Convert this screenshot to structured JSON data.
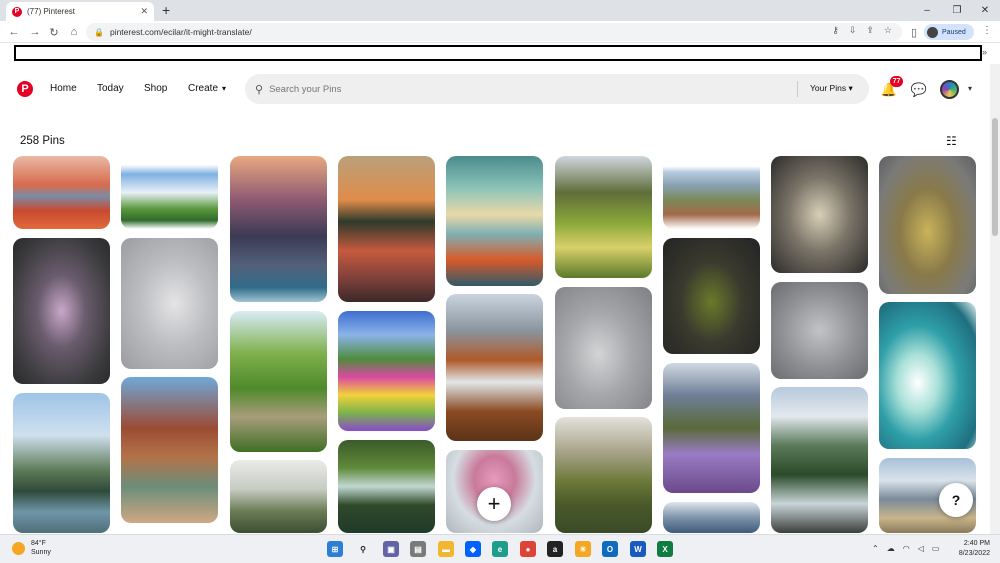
{
  "browser": {
    "tab_title": "(77) Pinterest",
    "tab_close": "✕",
    "new_tab": "+",
    "url": "pinterest.com/ecilar/it-might-translate/",
    "profile_label": "Paused",
    "window_controls": [
      "–",
      "❐",
      "✕"
    ],
    "more_bookmarks": "»"
  },
  "header": {
    "logo": "P",
    "nav": [
      "Home",
      "Today",
      "Shop",
      "Create"
    ],
    "create_chevron": "▾",
    "search_placeholder": "Search your Pins",
    "your_pins": "Your Pins",
    "your_pins_chevron": "▾",
    "notification_count": "77"
  },
  "board": {
    "pin_count": "258 Pins"
  },
  "fab": {
    "add": "+",
    "help": "?"
  },
  "taskbar": {
    "weather_temp": "84°F",
    "weather_desc": "Sunny",
    "time": "2:40 PM",
    "date": "8/23/2022"
  },
  "colors": {
    "pinterest_red": "#e60023",
    "search_bg": "#efefef"
  },
  "pins": [
    {
      "name": "pin-red-desert-lake",
      "bg": "linear-gradient(180deg,#e8b9a5 0%,#d86a4d 40%,#7b8da6 55%,#c9492f 75%,#e26a3b 100%)"
    },
    {
      "name": "pin-dancer-purple-gown",
      "bg": "radial-gradient(ellipse at 50% 50%,#c9a7c8 0%,#6a5c6e 35%,#3b3b3d 75%,#2a2a2c 100%)"
    },
    {
      "name": "pin-mountain-lake-forest",
      "bg": "linear-gradient(180deg,#9ec4e6 0%,#cfe0ef 30%,#5e7c5a 55%,#2f4a3a 70%,#6f96a8 85%,#4f6e78 100%)"
    },
    {
      "name": "pin-green-fields-clouds",
      "bg": "linear-gradient(180deg,#ffffff 0%,#ffffff 12%,#7fb1e2 25%,#e9f0f7 50%,#5c9a3e 72%,#2f6b2a 88%,#ffffff 100%)"
    },
    {
      "name": "pin-dancer-white-fabric",
      "bg": "radial-gradient(ellipse at 55% 50%,#e4e4e6 0%,#bdbec2 45%,#9a9ca0 100%)"
    },
    {
      "name": "pin-canyon-river-trees",
      "bg": "linear-gradient(180deg,#6fa8d8 0%,#9b4b34 35%,#b37349 55%,#6b8d7a 75%,#cfa883 100%)"
    },
    {
      "name": "pin-sunset-clouds-sea",
      "bg": "linear-gradient(180deg,#e7a881 0%,#8e5a72 30%,#3b3a55 55%,#54607a 75%,#2f6c8a 90%,#9fc4d2 100%)"
    },
    {
      "name": "pin-stone-wall-path",
      "bg": "linear-gradient(180deg,#d9ecf7 0%,#7fb04c 30%,#4f8a2b 55%,#a89d7b 75%,#3f6f24 100%)"
    },
    {
      "name": "pin-misty-village",
      "bg": "linear-gradient(180deg,#e9ebe8 0%,#c7cbc3 40%,#6b7d55 70%,#3d4d33 100%)"
    },
    {
      "name": "pin-island-sunset-reflection",
      "bg": "linear-gradient(180deg,#b9a07b 0%,#e08c4a 30%,#2e3a2c 45%,#c55a3e 65%,#7a3f3a 85%,#3a2a28 100%)"
    },
    {
      "name": "pin-flower-meadow-sea",
      "bg": "linear-gradient(180deg,#3d6fd1 0%,#8cb3e8 20%,#4e8c3d 40%,#d94aa1 55%,#f2d23b 70%,#7bb34a 85%,#8a4ac9 100%)"
    },
    {
      "name": "pin-forest-waterfall",
      "bg": "linear-gradient(180deg,#3b5a2a 0%,#5f8a3a 30%,#c0d8d2 50%,#2f4a2a 70%,#1f3a2a 100%)"
    },
    {
      "name": "pin-teal-storm-clouds",
      "bg": "linear-gradient(180deg,#4a8c8c 0%,#8dc4b9 25%,#e9d8a8 45%,#7fb0b3 60%,#d85a2a 80%,#2f5a6a 100%)"
    },
    {
      "name": "pin-waterfall-autumn-peaks",
      "bg": "linear-gradient(180deg,#c9d4de 0%,#8a949e 25%,#b05a2a 45%,#e2e7ea 60%,#8a4a22 80%,#5a3418 100%)"
    },
    {
      "name": "pin-pink-hair-portrait",
      "bg": "radial-gradient(ellipse at 50% 35%,#e79abc 0%,#c97a9a 30%,#d6dde2 60%,#aeb6bd 100%)"
    },
    {
      "name": "pin-green-valley-light",
      "bg": "linear-gradient(180deg,#cfd6de 0%,#5f6d3a 30%,#8aa83a 55%,#d9d06a 75%,#5a7a2a 100%)"
    },
    {
      "name": "pin-dancer-grey-backdrop",
      "bg": "radial-gradient(ellipse at 45% 55%,#d4d4d6 0%,#a4a6a9 45%,#7d7f82 100%)"
    },
    {
      "name": "pin-mossy-river-valley",
      "bg": "linear-gradient(180deg,#e3e2dc 0%,#a8a48a 30%,#6d7a3a 55%,#4a5a2a 75%,#3a4a28 100%)"
    },
    {
      "name": "pin-heather-plains",
      "bg": "linear-gradient(180deg,#ffffff 0%,#ffffff 14%,#b7cbe0 22%,#8aa1b3 40%,#7a8a5a 60%,#a36a4a 80%,#ffffff 100%)"
    },
    {
      "name": "pin-dancer-green-dress",
      "bg": "radial-gradient(ellipse at 50% 55%,#6a7a2a 0%,#3a3a2e 45%,#232325 100%)"
    },
    {
      "name": "pin-purple-heather-hills",
      "bg": "linear-gradient(180deg,#d0d8e3 0%,#6f7f96 25%,#5a6a3a 50%,#9a7bc4 70%,#6a4a8a 100%)"
    },
    {
      "name": "pin-sky-clouds-top",
      "bg": "linear-gradient(180deg,#dfe5ec 0%,#7e93ab 50%,#3f5a7a 100%)"
    },
    {
      "name": "pin-dancer-cream-gown",
      "bg": "radial-gradient(ellipse at 50% 50%,#d9cfb7 0%,#7a7468 45%,#2c2b2a 100%)"
    },
    {
      "name": "pin-dancer-leaping-grey",
      "bg": "radial-gradient(ellipse at 50% 50%,#c2c3c6 0%,#8e9094 55%,#6a6c70 100%)"
    },
    {
      "name": "pin-alpine-river-pines",
      "bg": "linear-gradient(180deg,#b7c9db 0%,#e3e8ee 20%,#5a7a5a 40%,#2a4a2a 60%,#c9d4d8 80%,#3a3f3a 100%)"
    },
    {
      "name": "pin-dancer-golden-silk",
      "bg": "radial-gradient(ellipse at 50% 55%,#c9b35a 0%,#8a7a4a 40%,#7a7a78 75%,#5e5f62 100%)"
    },
    {
      "name": "pin-teal-ocean-wave",
      "bg": "radial-gradient(ellipse at 40% 55%,#ffffff 0%,#a8e0d8 25%,#2f9fa8 50%,#1f6f80 80%,#e9f3f2 100%)"
    },
    {
      "name": "pin-mountain-village-mist",
      "bg": "linear-gradient(180deg,#a8c0d8 0%,#d9e3ea 30%,#7a8a9a 55%,#c9b58a 80%,#8a7a5a 100%)"
    }
  ]
}
